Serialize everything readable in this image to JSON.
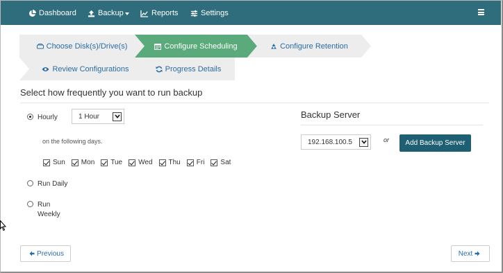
{
  "navbar": {
    "items": [
      {
        "label": "Dashboard",
        "icon": "pie-chart-icon"
      },
      {
        "label": "Backup",
        "icon": "upload-icon"
      },
      {
        "label": "Reports",
        "icon": "line-chart-icon"
      },
      {
        "label": "Settings",
        "icon": "sliders-icon"
      }
    ],
    "menu_icon": "hamburger-icon"
  },
  "wizard": {
    "steps": [
      {
        "label": "Choose Disk(s)/Drive(s)",
        "icon": "hdd-icon",
        "state": "done"
      },
      {
        "label": "Configure Scheduling",
        "icon": "calendar-icon",
        "state": "active"
      },
      {
        "label": "Configure Retention",
        "icon": "recycle-icon",
        "state": "pending"
      },
      {
        "label": "Review Configurations",
        "icon": "eye-icon",
        "state": "pending"
      },
      {
        "label": "Progress Details",
        "icon": "refresh-icon",
        "state": "pending"
      }
    ],
    "active_color": "#5aaa7b",
    "inactive_color": "#ededed"
  },
  "schedule": {
    "title": "Select how frequently you want to run backup",
    "options": [
      {
        "label": "Hourly",
        "checked": true
      },
      {
        "label": "Run Daily",
        "checked": false
      },
      {
        "label": "Run",
        "sub": "Weekly",
        "checked": false
      }
    ],
    "interval_value": "1 Hour",
    "days_note": "on the following days.",
    "days": [
      {
        "label": "Sun",
        "checked": true
      },
      {
        "label": "Mon",
        "checked": true
      },
      {
        "label": "Tue",
        "checked": true
      },
      {
        "label": "Wed",
        "checked": true
      },
      {
        "label": "Thu",
        "checked": true
      },
      {
        "label": "Fri",
        "checked": true
      },
      {
        "label": "Sat",
        "checked": true
      }
    ]
  },
  "backup_server": {
    "title": "Backup Server",
    "selected": "192.168.100.5",
    "or_text": "or",
    "add_label": "Add Backup Server"
  },
  "footer": {
    "previous_label": "Previous",
    "next_label": "Next"
  },
  "colors": {
    "navbar": "#2f6c7c",
    "primary_button": "#1e5f73",
    "link": "#2b6ca3"
  }
}
